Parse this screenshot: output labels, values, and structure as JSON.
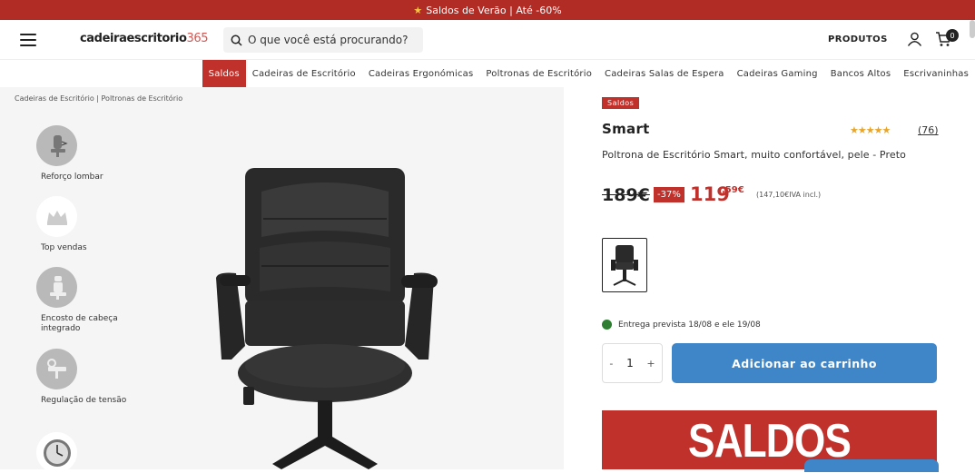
{
  "promo": {
    "text": "Saldos de Verão | Até -60%"
  },
  "header": {
    "logo_text": "cadeiraescritorio",
    "logo_num": "365",
    "search_placeholder": "O que você está procurando?",
    "produtos": "PRODUTOS",
    "cart_count": "0"
  },
  "nav": {
    "items": [
      {
        "label": "Saldos"
      },
      {
        "label": "Cadeiras de Escritório"
      },
      {
        "label": "Cadeiras Ergonómicas"
      },
      {
        "label": "Poltronas de Escritório"
      },
      {
        "label": "Cadeiras Salas de Espera"
      },
      {
        "label": "Cadeiras Gaming"
      },
      {
        "label": "Bancos Altos"
      },
      {
        "label": "Escrivaninhas"
      }
    ]
  },
  "breadcrumb": "Cadeiras de Escritório | Poltronas de Escritório",
  "features": [
    {
      "label": "Reforço lombar",
      "icon": "lumbar-support-icon"
    },
    {
      "label": "Top vendas",
      "icon": "crown-icon"
    },
    {
      "label": "Encosto de cabeça integrado",
      "icon": "headrest-icon"
    },
    {
      "label": "Regulação de tensão",
      "icon": "tension-icon"
    }
  ],
  "product": {
    "badge": "Saldos",
    "name": "Smart",
    "rating": 5,
    "stars": "★★★★★",
    "reviews": "(76)",
    "description": "Poltrona de Escritório Smart, muito confortável, pele - Preto",
    "old_price": "189€",
    "discount": "-37%",
    "new_price": "119",
    "new_cents": ",59€",
    "vat": "(147,10€IVA incl.)",
    "delivery": "Entrega prevista 18/08 e ele 19/08",
    "quantity": "1",
    "add_to_cart": "Adicionar ao carrinho",
    "banner_text": "SALDOS"
  },
  "colors": {
    "brand_red": "#c0312c",
    "cta_blue": "#3f86c9",
    "star": "#e8a52b",
    "delivery_green": "#2e7d32"
  }
}
